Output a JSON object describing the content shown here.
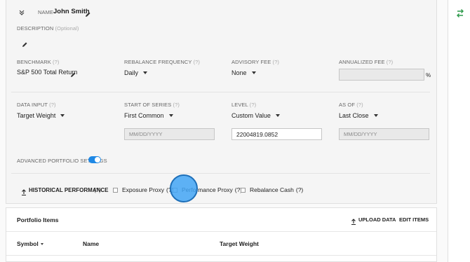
{
  "header": {
    "name_label": "NAME",
    "name_value": "John Smith"
  },
  "description": {
    "label": "DESCRIPTION",
    "optional": "(Optional)"
  },
  "row1": {
    "benchmark": {
      "label": "BENCHMARK",
      "help": "(?)",
      "value": "S&P 500 Total Return"
    },
    "rebalance_frequency": {
      "label": "REBALANCE FREQUENCY",
      "help": "(?)",
      "value": "Daily"
    },
    "advisory_fee": {
      "label": "ADVISORY FEE",
      "help": "(?)",
      "value": "None"
    },
    "annualized_fee": {
      "label": "ANNUALIZED FEE",
      "help": "(?)",
      "value": "",
      "suffix": "%"
    }
  },
  "row2": {
    "data_input": {
      "label": "DATA INPUT",
      "help": "(?)",
      "value": "Target Weight"
    },
    "start_of_series": {
      "label": "START OF SERIES",
      "help": "(?)",
      "value": "First Common",
      "placeholder": "MM/DD/YYYY"
    },
    "level": {
      "label": "LEVEL",
      "help": "(?)",
      "value": "Custom Value",
      "input_value": "22004819.0852"
    },
    "as_of": {
      "label": "AS OF",
      "help": "(?)",
      "value": "Last Close",
      "placeholder": "MM/DD/YYYY"
    }
  },
  "advanced": {
    "label": "ADVANCED PORTFOLIO SETTINGS",
    "enabled": true
  },
  "historical": {
    "label": "HISTORICAL PERFORMANCE",
    "help": "(?)",
    "options": [
      {
        "label": "Exposure Proxy",
        "help": "(?)",
        "checked": false
      },
      {
        "label": "Performance Proxy",
        "help": "(?)",
        "checked": false
      },
      {
        "label": "Rebalance Cash",
        "help": "(?)",
        "checked": false
      }
    ]
  },
  "portfolio": {
    "title": "Portfolio Items",
    "upload_label": "UPLOAD DATA",
    "edit_label": "EDIT ITEMS",
    "columns": [
      "Symbol",
      "Name",
      "Target Weight"
    ]
  },
  "colors": {
    "accent": "#1e88e5",
    "rail_icon": "#2e9a4b"
  }
}
